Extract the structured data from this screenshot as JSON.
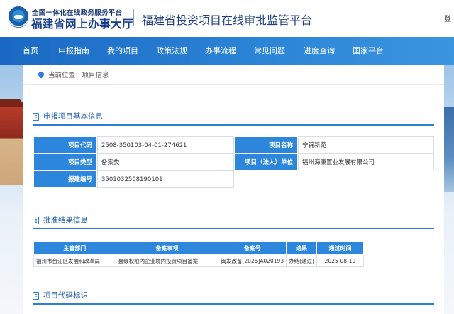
{
  "header": {
    "logo_line1": "全国一体化在线政务服务平台",
    "logo_line2": "福建省网上办事大厅",
    "site_title": "福建省投资项目在线审批监管平台",
    "top_right_text": "登"
  },
  "nav": {
    "items": [
      {
        "label": "首页"
      },
      {
        "label": "申报指南"
      },
      {
        "label": "我的项目"
      },
      {
        "label": "政策法规"
      },
      {
        "label": "办事流程"
      },
      {
        "label": "常见问题"
      },
      {
        "label": "进度查询"
      },
      {
        "label": "国家平台"
      }
    ]
  },
  "breadcrumb": {
    "prefix": "当前位置：",
    "current": "项目信息"
  },
  "sections": {
    "basic_info_title": "申报项目基本信息",
    "approval_title": "批准结果信息",
    "code_title": "项目代码标识"
  },
  "basic_info": {
    "project_code_label": "项目代码",
    "project_code": "2508-350103-04-01-274621",
    "project_name_label": "项目名称",
    "project_name": "宁锦新苑",
    "project_type_label": "项目类型",
    "project_type": "备案类",
    "legal_unit_label": "项目（法人）单位",
    "legal_unit": "福州海康置业发展有限公司",
    "report_no_label": "报建编号",
    "report_no": "3501032508190101"
  },
  "approval_table": {
    "headers": [
      "主管部门",
      "备案事项",
      "备案号",
      "结果",
      "通过时间"
    ],
    "rows": [
      [
        "福州市台江区发展和改革局",
        "县级权限内企业境内投资项目备案",
        "闽发改备[2025]A020193",
        "办结(通过)",
        "2025-08-19"
      ]
    ]
  },
  "colors": {
    "nav_blue": "#1a68c3",
    "label_blue": "#2b86dc",
    "title_navy": "#1d3f80"
  }
}
